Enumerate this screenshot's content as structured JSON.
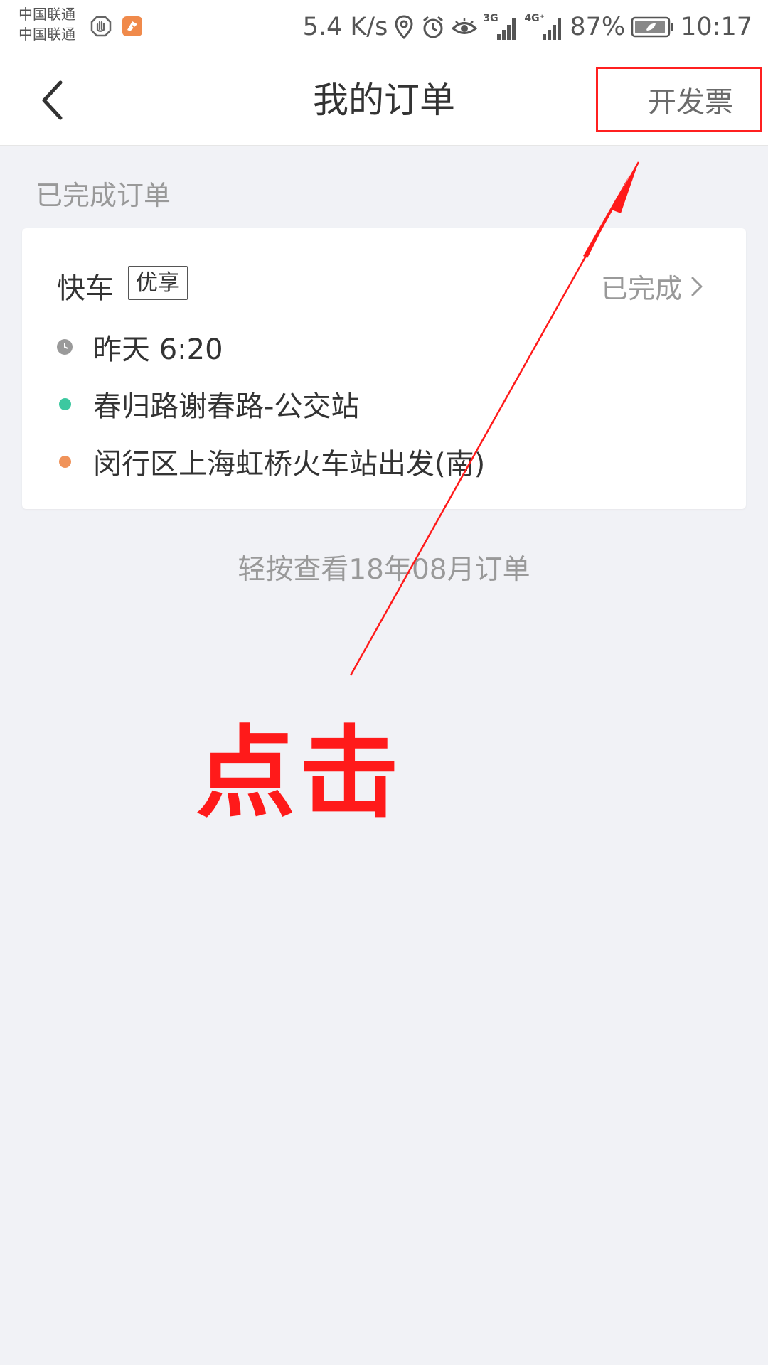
{
  "status_bar": {
    "carrier_1": "中国联通",
    "carrier_2": "中国联通",
    "net_speed": "5.4 K/s",
    "battery": "87%",
    "time": "10:17",
    "signal_1_label": "3G",
    "signal_2_label": "4G⁺",
    "icons": [
      "hand-app-icon",
      "orange-app-icon",
      "location-icon",
      "alarm-icon",
      "eye-icon",
      "signal-3g-icon",
      "signal-4g-icon",
      "battery-icon"
    ]
  },
  "nav": {
    "title": "我的订单",
    "invoice_label": "开发票",
    "back_icon": "chevron-left-icon"
  },
  "section": {
    "title": "已完成订单"
  },
  "order": {
    "service_type": "快车",
    "service_tag": "优享",
    "status": "已完成",
    "time": "昨天 6:20",
    "start": "春归路谢春路-公交站",
    "end": "闵行区上海虹桥火车站出发(南)",
    "colors": {
      "time_icon": "#9a9a9a",
      "start_dot": "#3cc8a0",
      "end_dot": "#f0935a"
    }
  },
  "more_link": "轻按查看18年08月订单",
  "annotation": {
    "text": "点击",
    "color": "#ff1a1a"
  }
}
